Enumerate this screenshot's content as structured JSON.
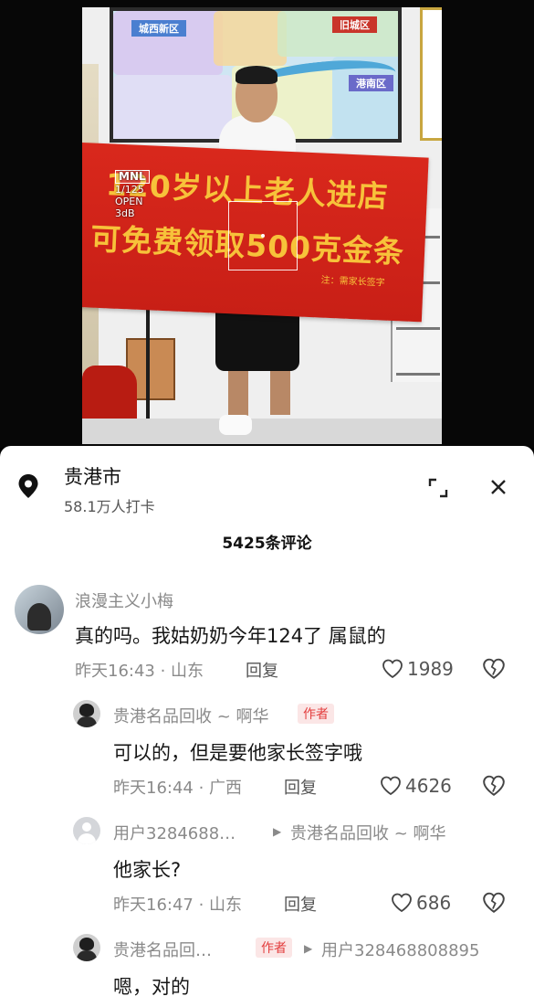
{
  "video": {
    "map_tags": [
      "城西新区",
      "旧城区",
      "港南区"
    ],
    "banner_line1": "120岁以上老人进店",
    "banner_line2": "可免费领取500克金条",
    "banner_note": "注：需家长签字",
    "camera_overlay": [
      "MNL",
      "1/125",
      "OPEN",
      "3dB"
    ]
  },
  "location": {
    "title": "贵港市",
    "subtitle": "58.1万人打卡"
  },
  "comments_count": "5425条评论",
  "comments": [
    {
      "user": "浪漫主义小梅",
      "text": "真的吗。我姑奶奶今年124了 属鼠的",
      "time_place": "昨天16:43 · 山东",
      "reply_label": "回复",
      "likes": "1989"
    },
    {
      "user": "贵港名品回收 ~ 啊华",
      "badge": "作者",
      "text": "可以的，但是要他家长签字哦",
      "time_place": "昨天16:44 · 广西",
      "reply_label": "回复",
      "likes": "4626"
    },
    {
      "user": "用户3284688…",
      "reply_to": "贵港名品回收 ~ 啊华",
      "text": "他家长?",
      "time_place": "昨天16:47 · 山东",
      "reply_label": "回复",
      "likes": "686"
    },
    {
      "user": "贵港名品回…",
      "badge": "作者",
      "reply_to": "用户328468808895",
      "text": "嗯，对的"
    }
  ],
  "icons": {
    "pin": "location-pin-icon",
    "expand": "expand-icon",
    "close": "close-icon",
    "like": "heart-icon",
    "dislike": "broken-heart-icon"
  },
  "colors": {
    "badge_bg": "#fbe6e6",
    "badge_text": "#e33d3d",
    "banner_red": "#d9281c",
    "banner_text": "#f7c23a"
  }
}
